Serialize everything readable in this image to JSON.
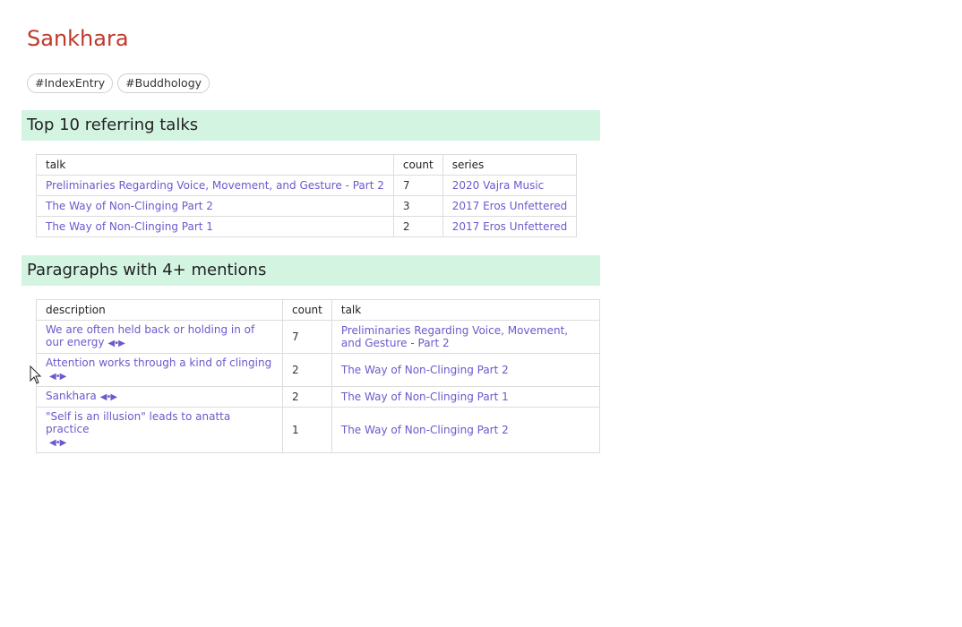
{
  "page": {
    "title": "Sankhara",
    "tags": [
      "#IndexEntry",
      "#Buddhology"
    ]
  },
  "top_talks": {
    "heading": "Top 10 referring talks",
    "columns": [
      "talk",
      "count",
      "series"
    ],
    "rows": [
      {
        "talk": "Preliminaries Regarding Voice, Movement, and Gesture - Part 2",
        "count": "7",
        "series": "2020 Vajra Music"
      },
      {
        "talk": "The Way of Non-Clinging Part 2",
        "count": "3",
        "series": "2017 Eros Unfettered"
      },
      {
        "talk": "The Way of Non-Clinging Part 1",
        "count": "2",
        "series": "2017 Eros Unfettered"
      }
    ]
  },
  "paragraphs": {
    "heading": "Paragraphs with 4+ mentions",
    "columns": [
      "description",
      "count",
      "talk"
    ],
    "nav_glyph": "◀•▶",
    "rows": [
      {
        "description": "We are often held back or holding in of our energy",
        "count": "7",
        "talk": "Preliminaries Regarding Voice, Movement, and Gesture - Part 2"
      },
      {
        "description": "Attention works through a kind of clinging",
        "count": "2",
        "talk": "The Way of Non-Clinging Part 2"
      },
      {
        "description": "Sankhara",
        "count": "2",
        "talk": "The Way of Non-Clinging Part 1"
      },
      {
        "description": "\"Self is an illusion\" leads to anatta practice",
        "count": "1",
        "talk": "The Way of Non-Clinging Part 2"
      }
    ]
  },
  "colors": {
    "title": "#c0392b",
    "link": "#6a5acd",
    "section_bg": "#d4f4e2"
  }
}
